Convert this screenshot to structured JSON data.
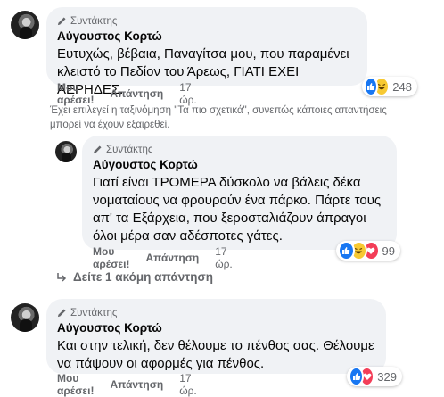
{
  "comments": [
    {
      "role": "Συντάκτης",
      "author": "Αύγουστος Κορτώ",
      "lines": [
        "Ευτυχώς, βέβαια, Παναγίτσα μου, που παραμένει",
        "κλειστό το Πεδίον του Άρεως, ΓΙΑΤΙ ΕΧΕΙ ΑΕΡΗΔΕΣ."
      ],
      "like": "Μου αρέσει!",
      "reply": "Απάντηση",
      "time": "17 ώρ.",
      "reactions_count": "248"
    },
    {
      "role": "Συντάκτης",
      "author": "Αύγουστος Κορτώ",
      "lines": [
        "Γιατί είναι ΤΡΟΜΕΡΑ δύσκολο να βάλεις δέκα",
        "νοματαίους να φρουρούν ένα πάρκο. Πάρτε τους",
        "απ' τα Εξάρχεια, που ξεροσταλιάζουν άπραγοι",
        "όλοι μέρα σαν αδέσποτες γάτες."
      ],
      "like": "Μου αρέσει!",
      "reply": "Απάντηση",
      "time": "17 ώρ.",
      "reactions_count": "99"
    },
    {
      "role": "Συντάκτης",
      "author": "Αύγουστος Κορτώ",
      "lines": [
        "Και στην τελική, δεν θέλουμε το πένθος σας. Θέλουμε",
        "να πάψουν οι αφορμές για πένθος."
      ],
      "like": "Μου αρέσει!",
      "reply": "Απάντηση",
      "time": "17 ώρ.",
      "reactions_count": "329"
    }
  ],
  "notice_lines": [
    "Έχει επιλεγεί η ταξινόμηση \"Τα πιο σχετικά\", συνεπώς κάποιες απαντήσεις",
    "μπορεί να έχουν εξαιρεθεί."
  ],
  "more_replies": "Δείτε 1 ακόμη απάντηση",
  "colors": {
    "like": "#1877f2",
    "haha": "#f7c932",
    "love": "#f33e58",
    "bubble": "#f0f2f5",
    "secondary_text": "#65676b"
  },
  "icons": [
    "pencil-icon",
    "like-reaction-icon",
    "haha-reaction-icon",
    "love-reaction-icon",
    "reply-arrow-icon"
  ]
}
